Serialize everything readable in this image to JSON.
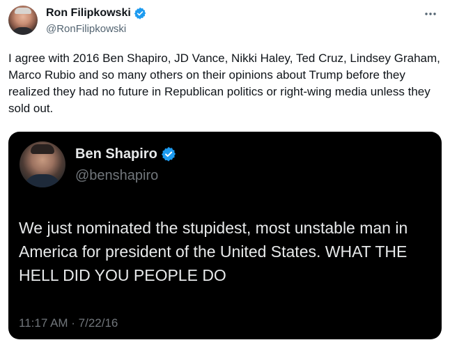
{
  "author": {
    "display_name": "Ron Filipkowski",
    "handle": "@RonFilipkowski",
    "verified": true
  },
  "more_icon": "ellipsis-icon",
  "tweet": {
    "text": "I agree with 2016 Ben Shapiro, JD Vance, Nikki Haley, Ted Cruz, Lindsey Graham, Marco Rubio and so many others on their opinions about Trump before they realized they had no future in Republican politics or right-wing media unless they sold out."
  },
  "quoted": {
    "display_name": "Ben Shapiro",
    "handle": "@benshapiro",
    "verified": true,
    "text": "We just nominated the stupidest, most unstable man in America for president of the United States. WHAT THE HELL DID YOU PEOPLE DO",
    "timestamp": "11:17 AM · 7/22/16"
  },
  "colors": {
    "verified_blue": "#1d9bf0",
    "text_primary": "#0f1419",
    "text_secondary": "#536471",
    "media_bg": "#000000"
  }
}
